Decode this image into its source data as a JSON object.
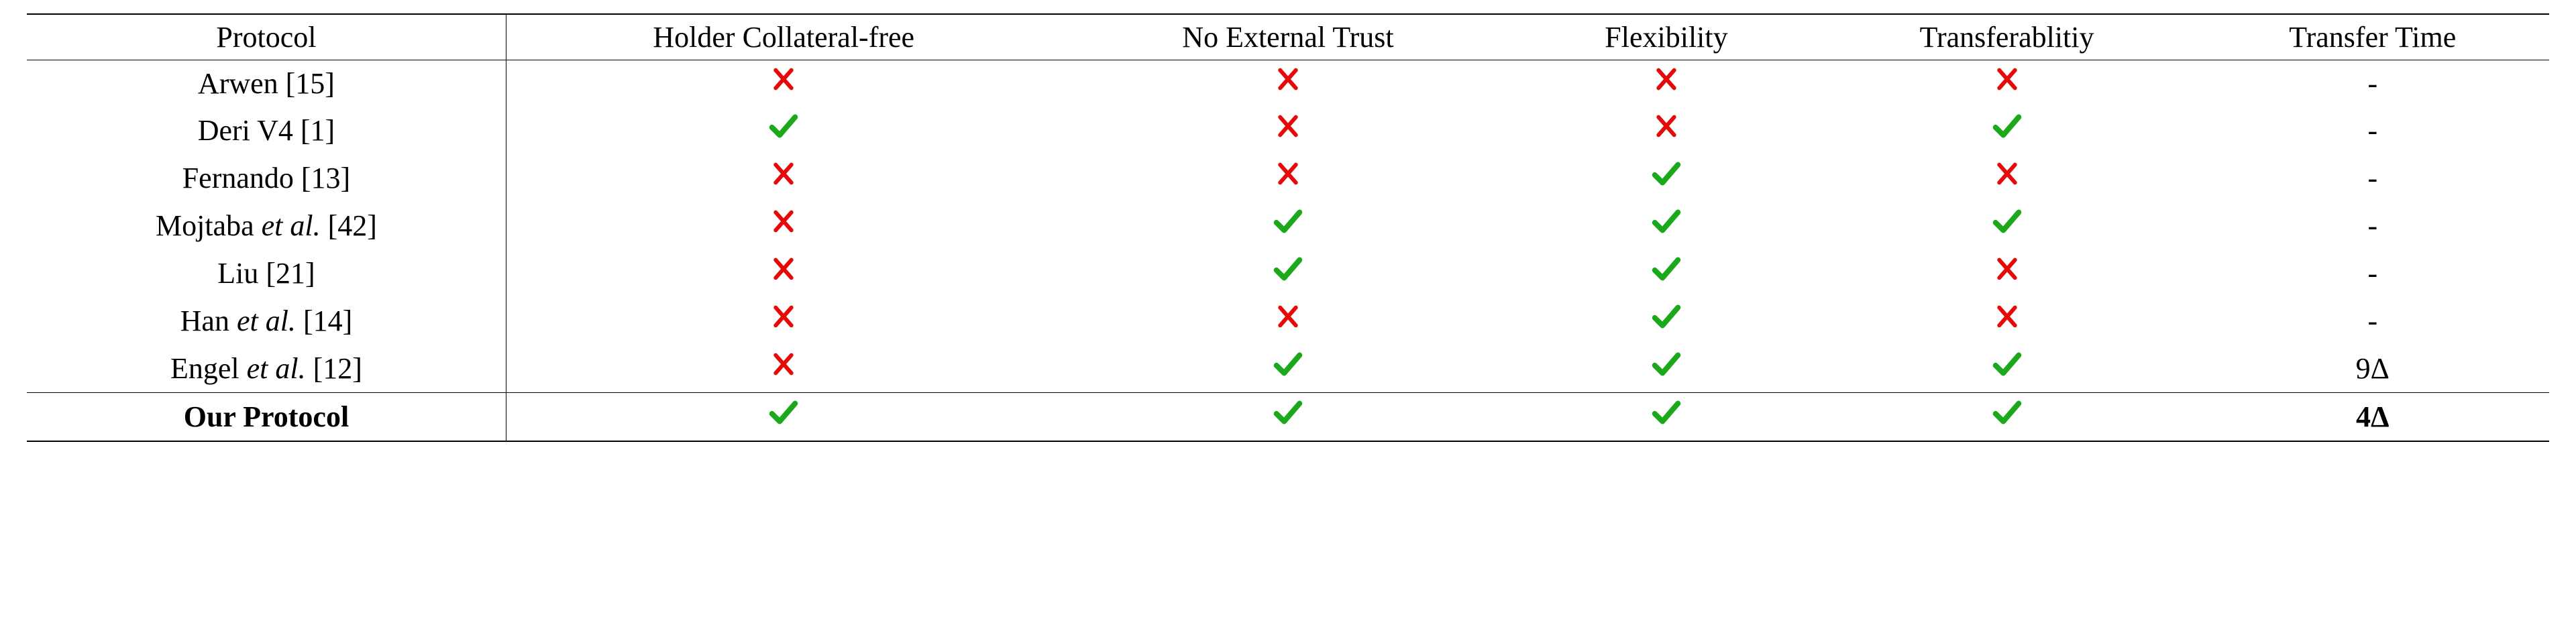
{
  "headers": {
    "protocol": "Protocol",
    "holder_collateral_free": "Holder Collateral-free",
    "no_external_trust": "No External Trust",
    "flexibility": "Flexibility",
    "transferability": "Transferablitiy",
    "transfer_time": "Transfer Time"
  },
  "rows": [
    {
      "protocol_html": "Arwen [15]",
      "hcf": "no",
      "net": "no",
      "flex": "no",
      "trans": "no",
      "time": "-"
    },
    {
      "protocol_html": "Deri V4 [1]",
      "hcf": "yes",
      "net": "no",
      "flex": "no",
      "trans": "yes",
      "time": "-"
    },
    {
      "protocol_html": "Fernando [13]",
      "hcf": "no",
      "net": "no",
      "flex": "yes",
      "trans": "no",
      "time": "-"
    },
    {
      "protocol_html": "Mojtaba <span class=\"italic\">et al.</span> [42]",
      "hcf": "no",
      "net": "yes",
      "flex": "yes",
      "trans": "yes",
      "time": "-"
    },
    {
      "protocol_html": "Liu [21]",
      "hcf": "no",
      "net": "yes",
      "flex": "yes",
      "trans": "no",
      "time": "-"
    },
    {
      "protocol_html": "Han <span class=\"italic\">et al.</span> [14]",
      "hcf": "no",
      "net": "no",
      "flex": "yes",
      "trans": "no",
      "time": "-"
    },
    {
      "protocol_html": "Engel <span class=\"italic\">et al.</span> [12]",
      "hcf": "no",
      "net": "yes",
      "flex": "yes",
      "trans": "yes",
      "time": "9Δ"
    },
    {
      "protocol_html": "<span class=\"bold\">Our Protocol</span>",
      "hcf": "yes",
      "net": "yes",
      "flex": "yes",
      "trans": "yes",
      "time": "4Δ",
      "is_our": true
    }
  ],
  "icon_colors": {
    "yes": "#1ba91b",
    "no": "#e40a0a"
  },
  "chart_data": {
    "type": "table",
    "title": "Protocol comparison",
    "columns": [
      "Protocol",
      "Holder Collateral-free",
      "No External Trust",
      "Flexibility",
      "Transferablitiy",
      "Transfer Time"
    ],
    "rows": [
      [
        "Arwen [15]",
        false,
        false,
        false,
        false,
        "-"
      ],
      [
        "Deri V4 [1]",
        true,
        false,
        false,
        true,
        "-"
      ],
      [
        "Fernando [13]",
        false,
        false,
        true,
        false,
        "-"
      ],
      [
        "Mojtaba et al. [42]",
        false,
        true,
        true,
        true,
        "-"
      ],
      [
        "Liu [21]",
        false,
        true,
        true,
        false,
        "-"
      ],
      [
        "Han et al. [14]",
        false,
        false,
        true,
        false,
        "-"
      ],
      [
        "Engel et al. [12]",
        false,
        true,
        true,
        true,
        "9Δ"
      ],
      [
        "Our Protocol",
        true,
        true,
        true,
        true,
        "4Δ"
      ]
    ]
  }
}
